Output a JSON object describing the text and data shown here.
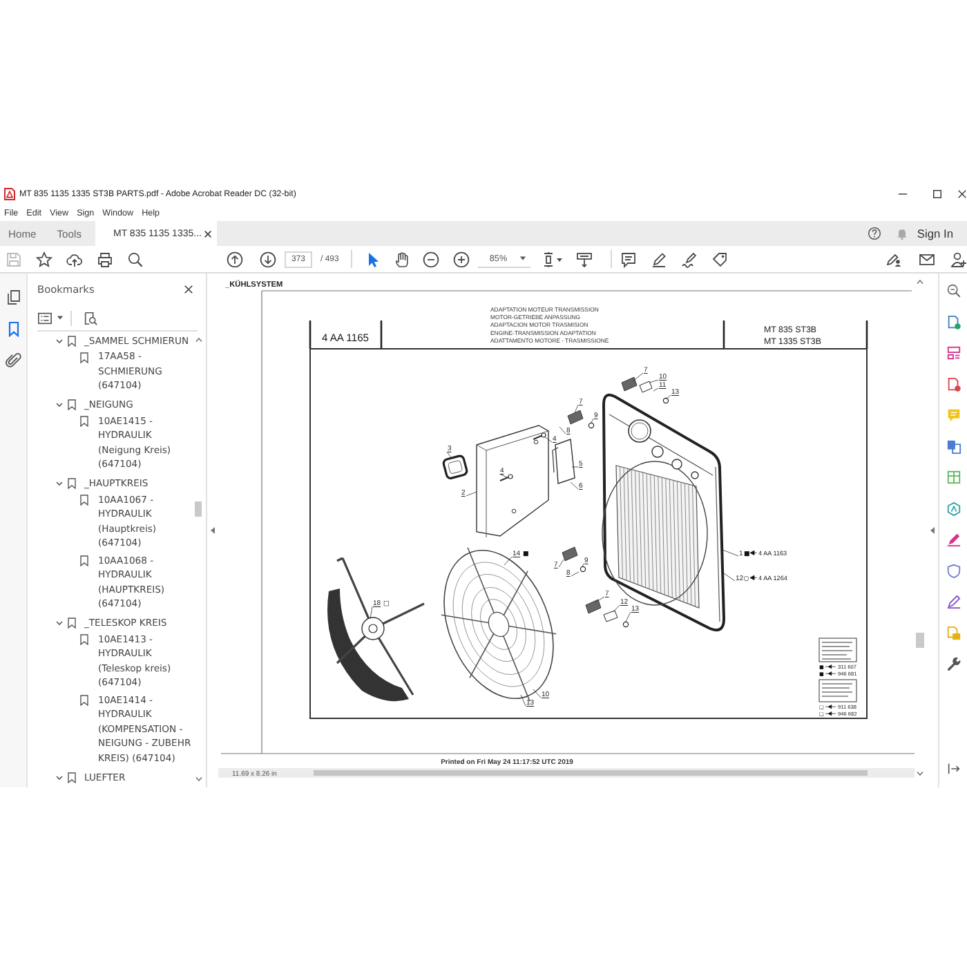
{
  "window": {
    "title": "MT 835 1135 1335 ST3B PARTS.pdf - Adobe Acrobat Reader DC (32-bit)"
  },
  "menu": [
    "File",
    "Edit",
    "View",
    "Sign",
    "Window",
    "Help"
  ],
  "tabs": [
    {
      "label": "Home",
      "kind": "nav",
      "selected": false
    },
    {
      "label": "Tools",
      "kind": "nav",
      "selected": false
    },
    {
      "label": "MT 835 1135 1335...",
      "kind": "document",
      "selected": true
    }
  ],
  "account": {
    "sign_in": "Sign In"
  },
  "toolbar": {
    "save_disabled": true,
    "page_number": "373",
    "page_count": "/ 493",
    "zoom": "85%",
    "tools": [
      {
        "kind": "select",
        "selected": true
      },
      {
        "kind": "hand",
        "selected": false
      }
    ]
  },
  "nav_rail": [
    {
      "kind": "pages",
      "selected": false
    },
    {
      "kind": "bookmarks",
      "selected": true
    },
    {
      "kind": "attachments",
      "selected": false
    }
  ],
  "bookmarks": {
    "title": "Bookmarks",
    "items": [
      {
        "label": "_SAMMEL SCHMIERUN",
        "expanded": true,
        "children": [
          {
            "label": "17AA58 - SCHMIERUNG (647104)"
          }
        ]
      },
      {
        "label": "_NEIGUNG",
        "expanded": true,
        "children": [
          {
            "label": "10AE1415 - HYDRAULIK (Neigung Kreis) (647104)"
          }
        ]
      },
      {
        "label": "_HAUPTKREIS",
        "expanded": true,
        "children": [
          {
            "label": "10AA1067 - HYDRAULIK (Hauptkreis) (647104)"
          },
          {
            "label": "10AA1068 - HYDRAULIK (HAUPTKREIS) (647104)"
          }
        ]
      },
      {
        "label": "_TELESKOP KREIS",
        "expanded": true,
        "children": [
          {
            "label": "10AE1413 - HYDRAULIK (Teleskop kreis) (647104)"
          },
          {
            "label": "10AE1414 - HYDRAULIK (KOMPENSATION - NEIGUNG - ZUBEHR KREIS) (647104)"
          }
        ]
      },
      {
        "label": "LUEFTER",
        "expanded": true
      }
    ]
  },
  "document": {
    "section": "_KÜHLSYSTEM",
    "drawing_number": "4 AA 1165",
    "title_lines": [
      "ADAPTATION MOTEUR TRANSMISSION",
      "MOTOR-GETRIEBE ANPASSUNG",
      "ADAPTACION MOTOR TRASMISION",
      "ENGINE-TRANSMISSION ADAPTATION",
      "ADATTAMENTO MOTORE - TRASMISSIONE"
    ],
    "models": [
      "MT 835 ST3B",
      "MT 1335 ST3B"
    ],
    "callouts": [
      {
        "number": "7"
      },
      {
        "number": "10"
      },
      {
        "number": "11"
      },
      {
        "number": "13"
      },
      {
        "number": "7"
      },
      {
        "number": "9"
      },
      {
        "number": "8"
      },
      {
        "number": "4"
      },
      {
        "number": "3"
      },
      {
        "number": "5"
      },
      {
        "number": "4"
      },
      {
        "number": "6"
      },
      {
        "number": "2"
      },
      {
        "number": "14",
        "marker": "■"
      },
      {
        "number": "9"
      },
      {
        "number": "7"
      },
      {
        "number": "8"
      },
      {
        "number": "7"
      },
      {
        "number": "12"
      },
      {
        "number": "18",
        "marker": "□"
      },
      {
        "number": "13"
      },
      {
        "number": "10"
      },
      {
        "number": "13"
      }
    ],
    "references": [
      {
        "number": "1",
        "marker": "■",
        "part": "4 AA 1163"
      },
      {
        "number": "12",
        "marker": "○",
        "part": "4 AA 1264"
      }
    ],
    "legend": [
      {
        "marker": "■",
        "code": "311 607"
      },
      {
        "marker": "■",
        "code": "946 681"
      },
      {
        "marker": "□",
        "code": "911 638"
      },
      {
        "marker": "□",
        "code": "946 682"
      }
    ],
    "printed": "Printed on  Fri May 24 11:17:52 UTC 2019",
    "page_size": "11.69 x 8.26 in"
  }
}
